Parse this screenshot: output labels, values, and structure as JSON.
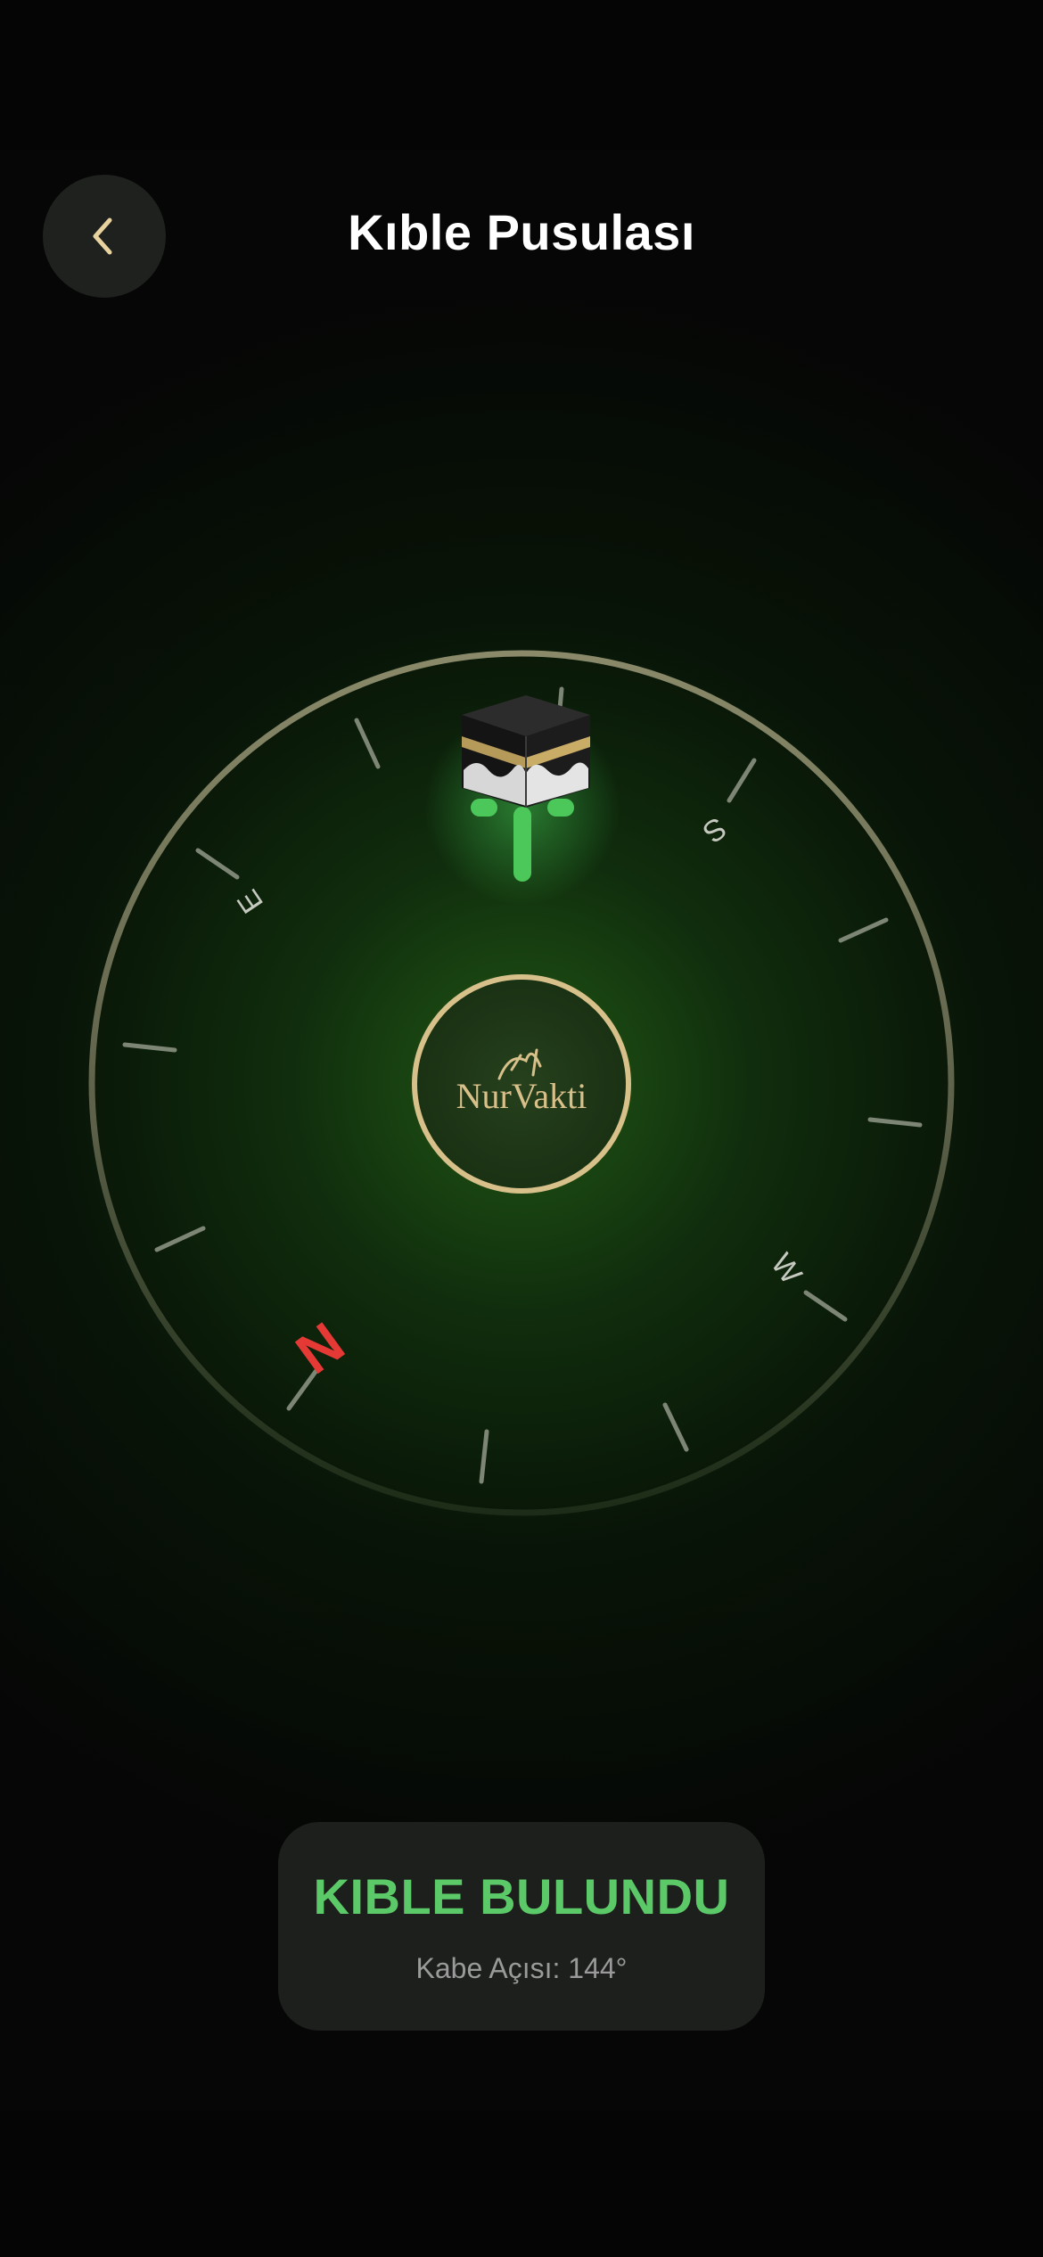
{
  "header": {
    "title": "Kıble Pusulası",
    "back_icon": "chevron-left-icon"
  },
  "compass": {
    "directions": {
      "north": "N",
      "east": "E",
      "south": "S",
      "west": "W"
    },
    "north_color": "#e53935",
    "logo_text": "NurVakti",
    "qibla_icon": "kaaba-icon"
  },
  "status": {
    "title": "KIBLE BULUNDU",
    "angle_text": "Kabe Açısı: 144°"
  },
  "colors": {
    "accent_green": "#5cc968",
    "gold": "#d8c08a"
  }
}
